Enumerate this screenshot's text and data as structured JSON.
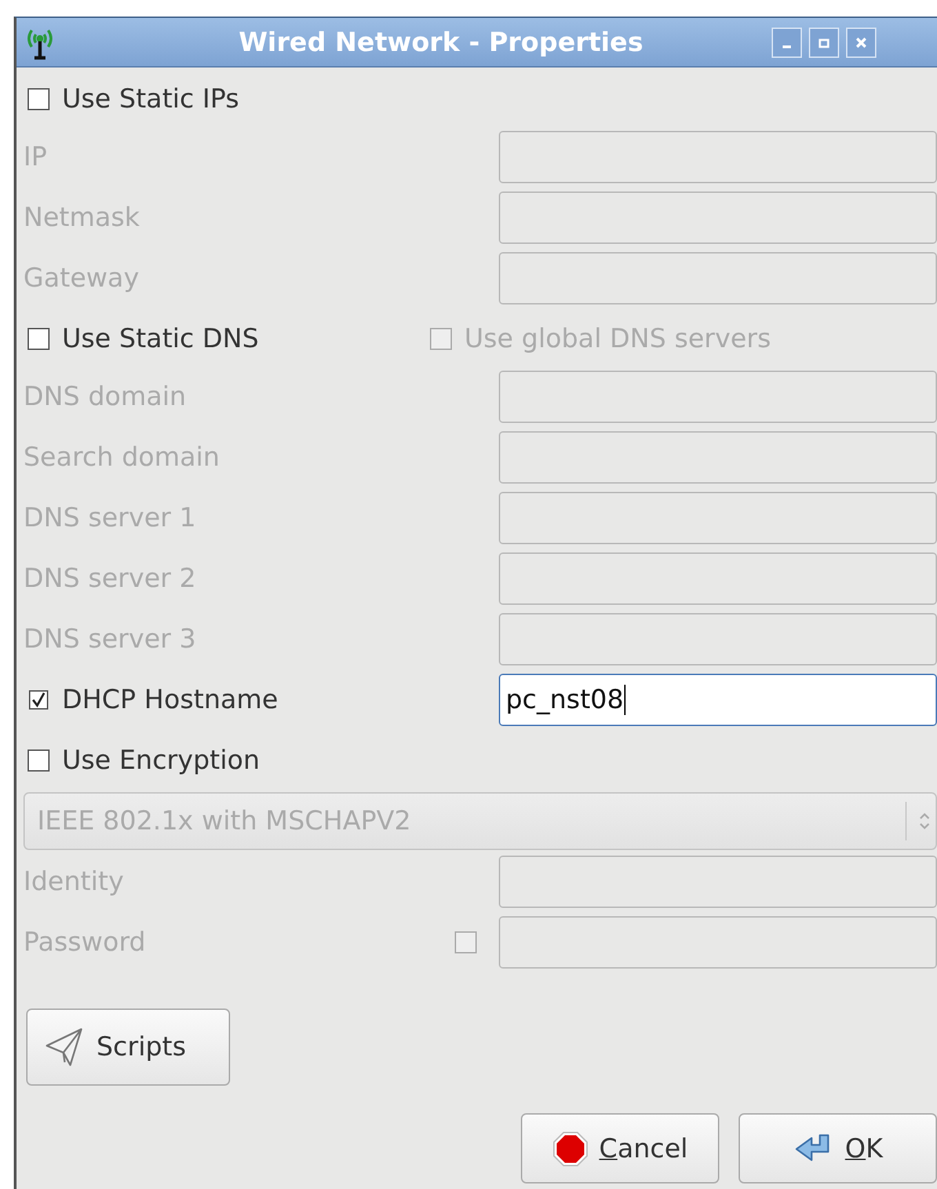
{
  "window": {
    "title": "Wired Network - Properties"
  },
  "rows": [
    {
      "kind": "checkbox",
      "label": "Use Static IPs",
      "checked": false
    },
    {
      "kind": "field",
      "label": "IP",
      "disabled": true
    },
    {
      "kind": "field",
      "label": "Netmask",
      "disabled": true
    },
    {
      "kind": "field",
      "label": "Gateway",
      "disabled": true
    },
    {
      "kind": "checkpair",
      "label": "Use Static DNS",
      "checked": false,
      "second": {
        "label": "Use global DNS servers",
        "checked": false,
        "disabled": true
      }
    },
    {
      "kind": "field",
      "label": "DNS domain",
      "disabled": true
    },
    {
      "kind": "field",
      "label": "Search domain",
      "disabled": true
    },
    {
      "kind": "field",
      "label": "DNS server 1",
      "disabled": true
    },
    {
      "kind": "field",
      "label": "DNS server 2",
      "disabled": true
    },
    {
      "kind": "field",
      "label": "DNS server 3",
      "disabled": true
    },
    {
      "kind": "checkfield",
      "label": "DHCP Hostname",
      "checked": true,
      "value": "pc_nst08"
    },
    {
      "kind": "checkbox",
      "label": "Use Encryption",
      "checked": false
    },
    {
      "kind": "select",
      "value": "IEEE 802.1x with MSCHAPV2",
      "disabled": true
    },
    {
      "kind": "field",
      "label": "Identity",
      "disabled": true
    },
    {
      "kind": "password",
      "label": "Password",
      "disabled": true,
      "show": false
    }
  ],
  "scripts_button": "Scripts",
  "buttons": [
    {
      "kind": "cancel",
      "label": "Cancel"
    },
    {
      "kind": "ok",
      "label": "OK"
    }
  ]
}
